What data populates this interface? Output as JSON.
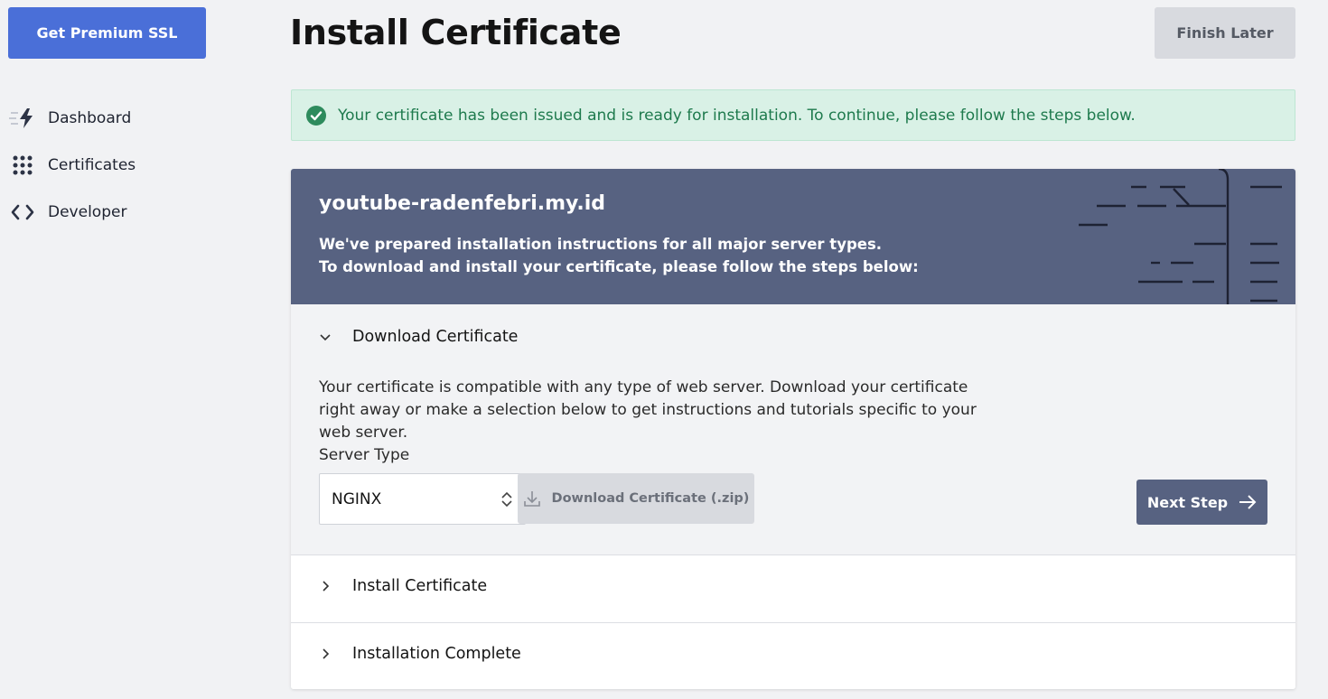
{
  "sidebar": {
    "premium_button": "Get Premium SSL",
    "items": [
      {
        "label": "Dashboard",
        "icon": "bolt-icon"
      },
      {
        "label": "Certificates",
        "icon": "grid-icon"
      },
      {
        "label": "Developer",
        "icon": "code-icon"
      }
    ]
  },
  "header": {
    "title": "Install Certificate",
    "finish_later": "Finish Later"
  },
  "alert": {
    "text": "Your certificate has been issued and is ready for installation. To continue, please follow the steps below.",
    "icon": "check-circle-icon"
  },
  "card": {
    "domain": "youtube-radenfebri.my.id",
    "intro_line1": "We've prepared installation instructions for all major server types.",
    "intro_line2": "To download and install your certificate, please follow the steps below:",
    "steps": [
      {
        "title": "Download Certificate",
        "expanded": true,
        "description": "Your certificate is compatible with any type of web server. Download your certificate right away or make a selection below to get instructions and tutorials specific to your web server.",
        "server_type_label": "Server Type",
        "server_type_value": "NGINX",
        "download_button": "Download Certificate (.zip)",
        "next_button": "Next Step"
      },
      {
        "title": "Install Certificate",
        "expanded": false
      },
      {
        "title": "Installation Complete",
        "expanded": false
      }
    ]
  },
  "colors": {
    "primary": "#4a6fd8",
    "header_bg": "#576281",
    "success_bg": "#d9f1e6",
    "success_text": "#1e7a4d"
  }
}
